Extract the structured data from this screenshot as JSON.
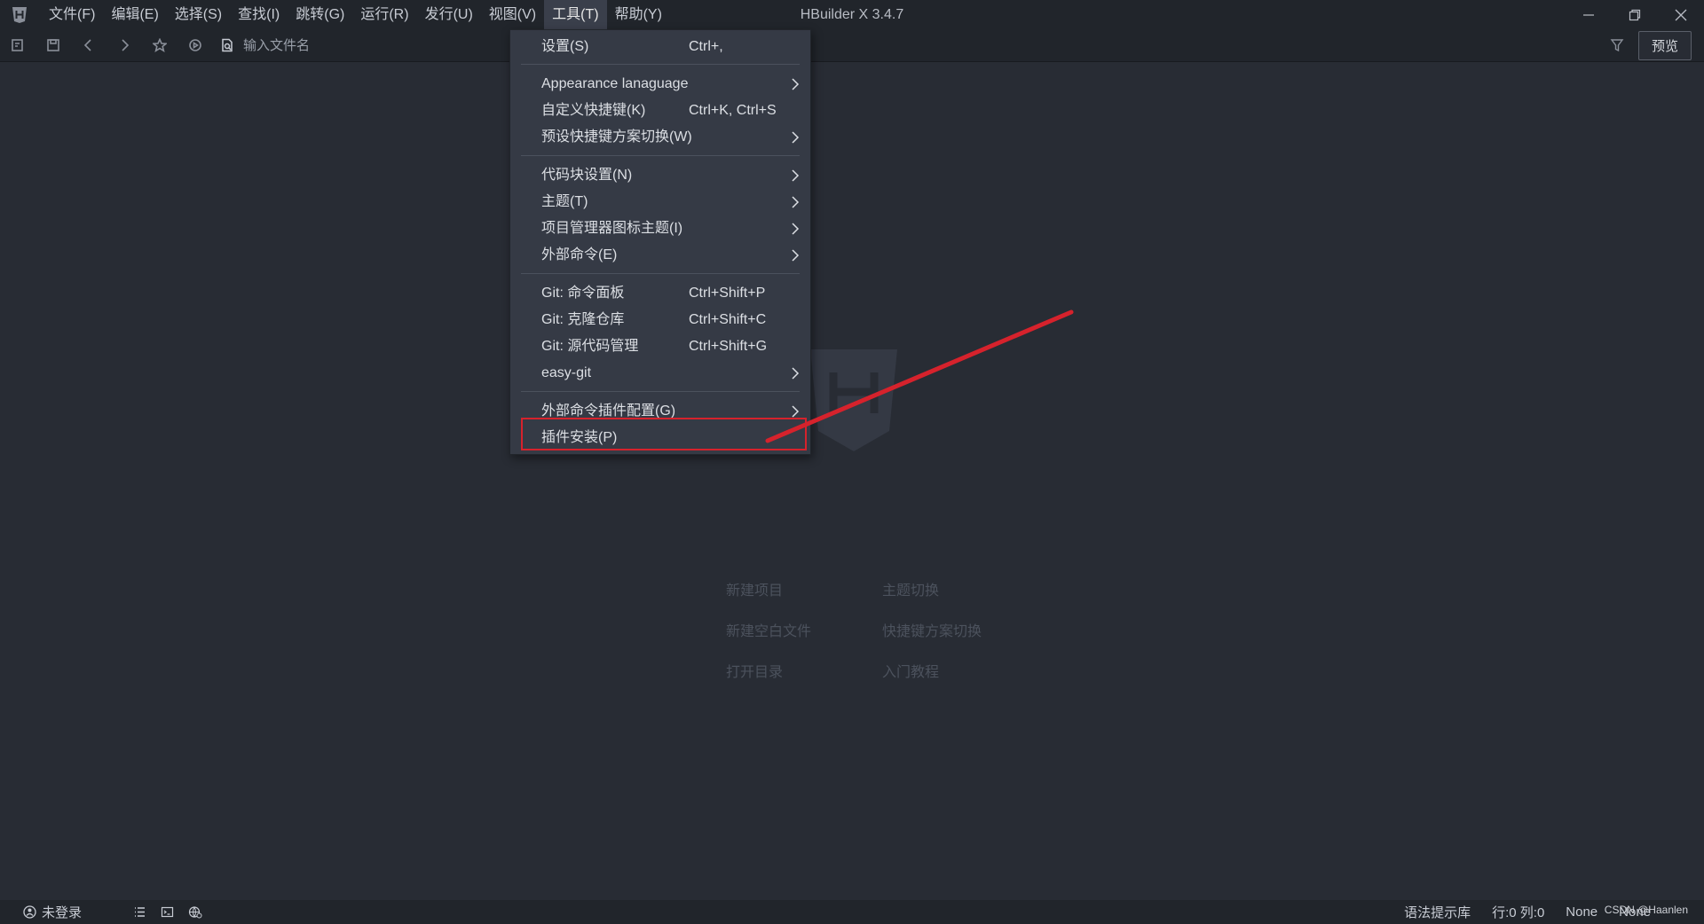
{
  "window": {
    "title": "HBuilder X 3.4.7"
  },
  "menubar": {
    "items": [
      {
        "label": "文件(F)"
      },
      {
        "label": "编辑(E)"
      },
      {
        "label": "选择(S)"
      },
      {
        "label": "查找(I)"
      },
      {
        "label": "跳转(G)"
      },
      {
        "label": "运行(R)"
      },
      {
        "label": "发行(U)"
      },
      {
        "label": "视图(V)"
      },
      {
        "label": "工具(T)"
      },
      {
        "label": "帮助(Y)"
      }
    ],
    "active": "工具(T)"
  },
  "toolbar": {
    "file_search_placeholder": "输入文件名",
    "preview_label": "预览"
  },
  "tools_menu": {
    "items": [
      {
        "label": "设置(S)",
        "shortcut": "Ctrl+,"
      },
      {
        "label": "Appearance lanaguage",
        "shortcut": "",
        "submenu": true
      },
      {
        "label": "自定义快捷键(K)",
        "shortcut": "Ctrl+K, Ctrl+S"
      },
      {
        "label": "预设快捷键方案切换(W)",
        "shortcut": "",
        "submenu": true
      },
      {
        "label": "代码块设置(N)",
        "shortcut": "",
        "submenu": true
      },
      {
        "label": "主题(T)",
        "shortcut": "",
        "submenu": true
      },
      {
        "label": "项目管理器图标主题(I)",
        "shortcut": "",
        "submenu": true
      },
      {
        "label": "外部命令(E)",
        "shortcut": "",
        "submenu": true
      },
      {
        "label": "Git: 命令面板",
        "shortcut": "Ctrl+Shift+P"
      },
      {
        "label": "Git: 克隆仓库",
        "shortcut": "Ctrl+Shift+C"
      },
      {
        "label": "Git: 源代码管理",
        "shortcut": "Ctrl+Shift+G"
      },
      {
        "label": "easy-git",
        "shortcut": "",
        "submenu": true
      },
      {
        "label": "外部命令插件配置(G)",
        "shortcut": "",
        "submenu": true
      },
      {
        "label": "插件安装(P)",
        "shortcut": "",
        "highlighted": true
      }
    ]
  },
  "welcome": {
    "links": [
      "新建项目",
      "主题切换",
      "新建空白文件",
      "快捷键方案切换",
      "打开目录",
      "入门教程"
    ]
  },
  "statusbar": {
    "login": "未登录",
    "syntax": "语法提示库",
    "position": "行:0  列:0",
    "encoding": "None",
    "language": "None",
    "watermark": "CSDN @Haanlen"
  },
  "colors": {
    "background": "#282c34",
    "titlebar": "#21252b",
    "menu": "#353a45",
    "annotation": "#d6222c"
  }
}
